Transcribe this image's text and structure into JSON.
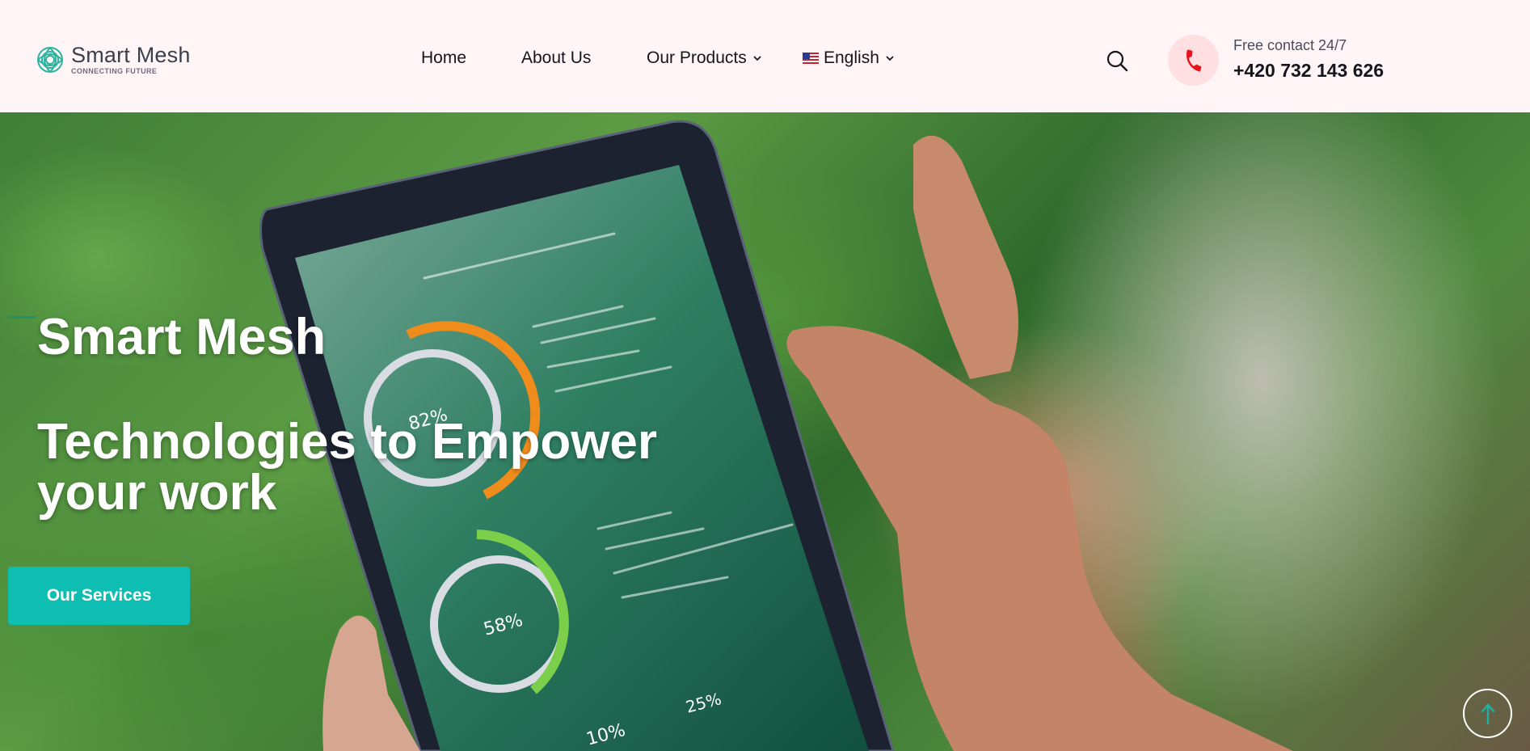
{
  "brand": {
    "name": "Smart Mesh",
    "tagline": "CONNECTING FUTURE",
    "accent_color": "#1bb3a5"
  },
  "nav": {
    "items": [
      {
        "label": "Home"
      },
      {
        "label": "About Us"
      },
      {
        "label": "Our Products",
        "has_dropdown": true
      }
    ],
    "language": {
      "label": "English",
      "flag": "us-flag-icon"
    }
  },
  "contact": {
    "label": "Free contact 24/7",
    "phone": "+420 732 143 626",
    "icon": "phone-icon",
    "icon_color": "#e8131b"
  },
  "hero": {
    "title": "Smart Mesh",
    "subtitle": "Technologies to Empower your work",
    "cta_label": "Our Services",
    "cta_color": "#0fbeb3",
    "tablet_readouts": [
      "82%",
      "58%",
      "10%",
      "25%"
    ]
  },
  "icons": {
    "search": "search-icon",
    "scroll_top": "arrow-up-icon"
  }
}
